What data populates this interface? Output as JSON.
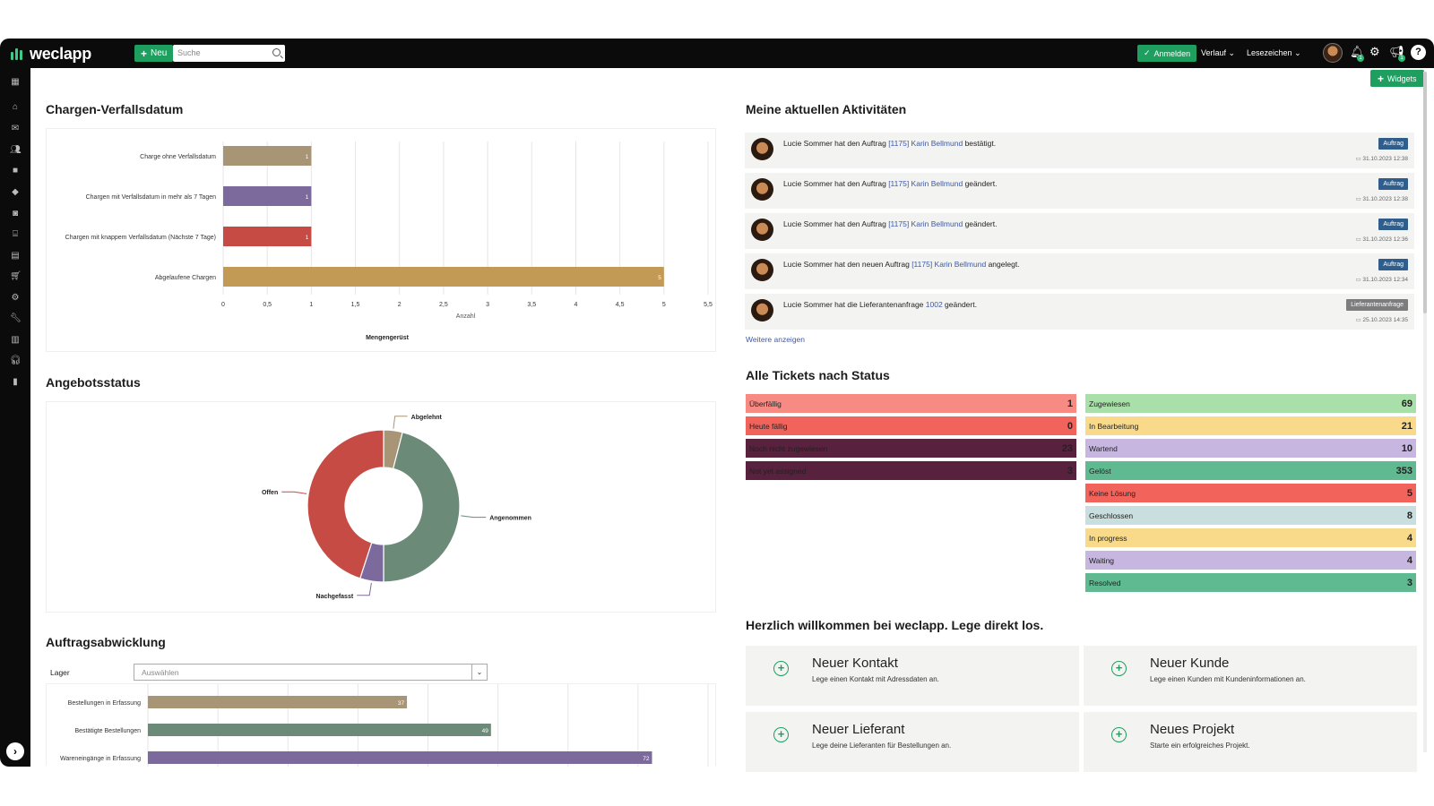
{
  "topbar": {
    "logo": "weclapp",
    "new_label": "Neu",
    "search_placeholder": "Suche",
    "login_label": "Anmelden",
    "history_label": "Verlauf",
    "bookmarks_label": "Lesezeichen",
    "notifications_count": "1",
    "announcements_count": "1",
    "help_label": "?"
  },
  "widgets_label": "Widgets",
  "batch_widget": {
    "title": "Chargen-Verfallsdatum",
    "chart_data": {
      "type": "bar",
      "orientation": "horizontal",
      "categories": [
        "Charge ohne Verfallsdatum",
        "Chargen mit Verfallsdatum in mehr als 7 Tagen",
        "Chargen mit knappem Verfallsdatum (Nächste 7 Tage)",
        "Abgelaufene Chargen"
      ],
      "values": [
        1,
        1,
        1,
        5
      ],
      "colors": [
        "#a89575",
        "#7d6a9c",
        "#c64b45",
        "#c29a56"
      ],
      "xticks": [
        "0",
        "0,5",
        "1",
        "1,5",
        "2",
        "2,5",
        "3",
        "3,5",
        "4",
        "4,5",
        "5",
        "5,5"
      ],
      "xlim": [
        0,
        5.5
      ],
      "xlabel": "Anzahl",
      "caption": "Mengengerüst"
    }
  },
  "quote_widget": {
    "title": "Angebotsstatus",
    "chart_data": {
      "type": "pie",
      "donut": true,
      "slices": [
        {
          "label": "Abgelehnt",
          "value": 4,
          "color": "#a89575"
        },
        {
          "label": "Angenommen",
          "value": 46,
          "color": "#6b8a78"
        },
        {
          "label": "Nachgefasst",
          "value": 5,
          "color": "#7d6a9c"
        },
        {
          "label": "Offen",
          "value": 45,
          "color": "#c64b45"
        }
      ]
    }
  },
  "orders_widget": {
    "title": "Auftragsabwicklung",
    "warehouse_label": "Lager",
    "warehouse_placeholder": "Auswählen",
    "chart_data": {
      "type": "bar",
      "orientation": "horizontal",
      "categories": [
        "Bestellungen in Erfassung",
        "Bestätigte Bestellungen",
        "Wareneingänge in Erfassung"
      ],
      "values": [
        37,
        49,
        72
      ],
      "colors": [
        "#a89575",
        "#6b8a78",
        "#7d6a9c"
      ],
      "xlim": [
        0,
        80
      ]
    }
  },
  "activities": {
    "title": "Meine aktuellen Aktivitäten",
    "items": [
      {
        "pre": "Lucie Sommer hat den Auftrag ",
        "link": "[1175] Karin Bellmund",
        "post": " bestätigt.",
        "tag": "Auftrag",
        "time": "31.10.2023 12:38"
      },
      {
        "pre": "Lucie Sommer hat den Auftrag ",
        "link": "[1175] Karin Bellmund",
        "post": " geändert.",
        "tag": "Auftrag",
        "time": "31.10.2023 12:38"
      },
      {
        "pre": "Lucie Sommer hat den Auftrag ",
        "link": "[1175] Karin Bellmund",
        "post": " geändert.",
        "tag": "Auftrag",
        "time": "31.10.2023 12:36"
      },
      {
        "pre": "Lucie Sommer hat den neuen Auftrag ",
        "link": "[1175] Karin Bellmund",
        "post": " angelegt.",
        "tag": "Auftrag",
        "time": "31.10.2023 12:34"
      },
      {
        "pre": "Lucie Sommer hat die Lieferantenanfrage ",
        "link": "1002",
        "post": " geändert.",
        "tag": "Lieferantenanfrage",
        "time": "25.10.2023 14:35"
      }
    ],
    "more_label": "Weitere anzeigen"
  },
  "tickets": {
    "title": "Alle Tickets nach Status",
    "left": [
      {
        "label": "Überfällig",
        "count": "1",
        "color": "#f78b84",
        "text": "#222"
      },
      {
        "label": "Heute fällig",
        "count": "0",
        "color": "#f2635c",
        "text": "#222"
      },
      {
        "label": "Noch nicht zugewiesen",
        "count": "23",
        "color": "#58213d",
        "text": "#222"
      },
      {
        "label": "Not yet assigned",
        "count": "3",
        "color": "#58213d",
        "text": "#222"
      }
    ],
    "right": [
      {
        "label": "Zugewiesen",
        "count": "69",
        "color": "#a9dfa9"
      },
      {
        "label": "In Bearbeitung",
        "count": "21",
        "color": "#f8da8a"
      },
      {
        "label": "Wartend",
        "count": "10",
        "color": "#c6b6e0"
      },
      {
        "label": "Gelöst",
        "count": "353",
        "color": "#5fba92"
      },
      {
        "label": "Keine Lösung",
        "count": "5",
        "color": "#f2635c"
      },
      {
        "label": "Geschlossen",
        "count": "8",
        "color": "#c9dede"
      },
      {
        "label": "In progress",
        "count": "4",
        "color": "#f8da8a"
      },
      {
        "label": "Waiting",
        "count": "4",
        "color": "#c6b6e0"
      },
      {
        "label": "Resolved",
        "count": "3",
        "color": "#5fba92"
      }
    ]
  },
  "welcome": {
    "title": "Herzlich willkommen bei weclapp. Lege direkt los.",
    "tiles": [
      {
        "title": "Neuer Kontakt",
        "sub": "Lege einen Kontakt mit Adressdaten an."
      },
      {
        "title": "Neuer Kunde",
        "sub": "Lege einen Kunden mit Kundeninformationen an."
      },
      {
        "title": "Neuer Lieferant",
        "sub": "Lege deine Lieferanten für Bestellungen an."
      },
      {
        "title": "Neues Projekt",
        "sub": "Starte ein erfolgreiches Projekt."
      }
    ]
  },
  "sidebar": {
    "icons": [
      "dashboard-icon",
      "home-icon",
      "mail-icon",
      "contacts-icon",
      "sales-icon",
      "tag-icon",
      "shield-icon",
      "bank-icon",
      "accounting-icon",
      "cart-icon",
      "production-icon",
      "wrench-icon",
      "document-icon",
      "headset-icon",
      "analytics-icon"
    ],
    "expand_label": "›"
  }
}
